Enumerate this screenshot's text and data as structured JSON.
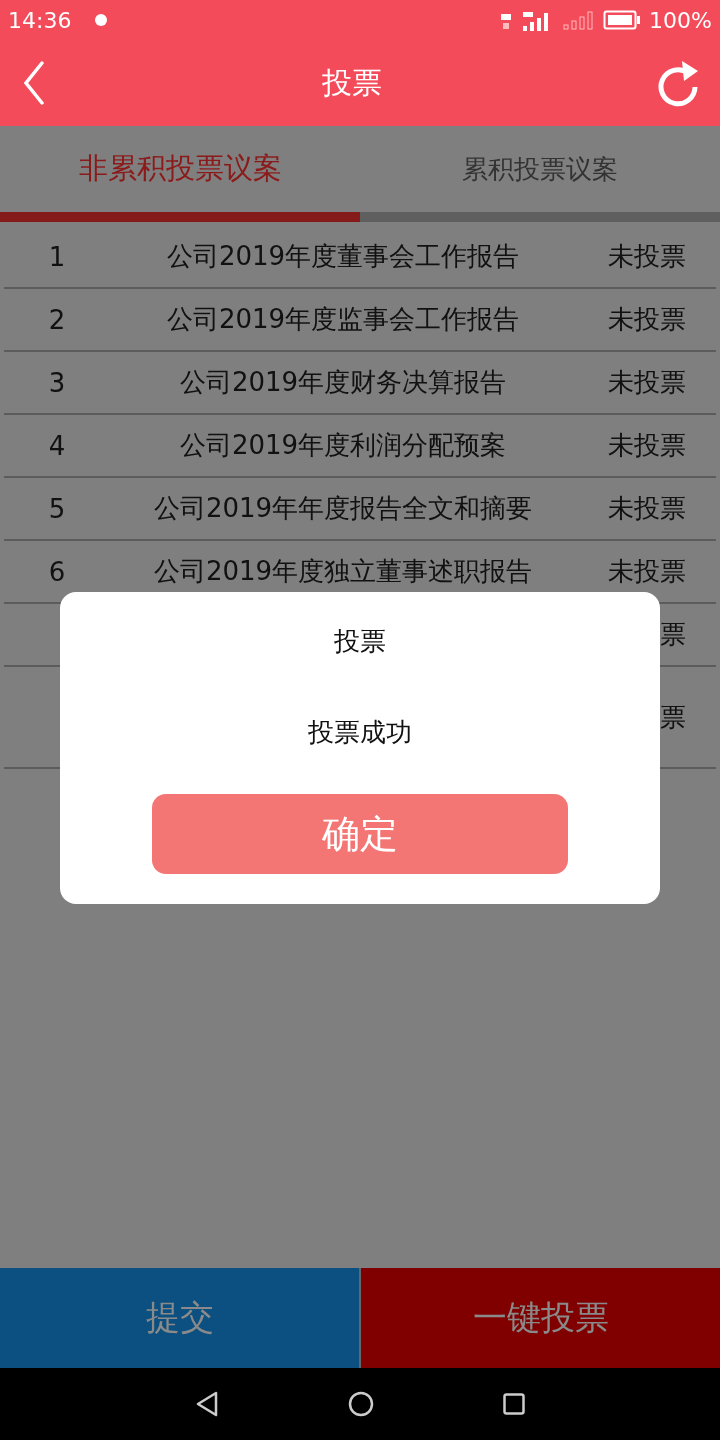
{
  "status_bar": {
    "time": "14:36",
    "battery": "100%"
  },
  "header": {
    "title": "投票"
  },
  "tabs": [
    {
      "label": "非累积投票议案",
      "selected": true
    },
    {
      "label": "累积投票议案",
      "selected": false
    }
  ],
  "rows": [
    {
      "number": "1",
      "title": "公司2019年度董事会工作报告",
      "status": "未投票"
    },
    {
      "number": "2",
      "title": "公司2019年度监事会工作报告",
      "status": "未投票"
    },
    {
      "number": "3",
      "title": "公司2019年度财务决算报告",
      "status": "未投票"
    },
    {
      "number": "4",
      "title": "公司2019年度利润分配预案",
      "status": "未投票"
    },
    {
      "number": "5",
      "title": "公司2019年年度报告全文和摘要",
      "status": "未投票"
    },
    {
      "number": "6",
      "title": "公司2019年度独立董事述职报告",
      "status": "未投票"
    },
    {
      "status": "票"
    },
    {
      "status": "票"
    }
  ],
  "dialog": {
    "title": "投票",
    "message": "投票成功",
    "button": "确定"
  },
  "bottom_buttons": [
    {
      "label": "提交",
      "kind": "submit"
    },
    {
      "label": "一键投票",
      "kind": "vote-all"
    }
  ]
}
